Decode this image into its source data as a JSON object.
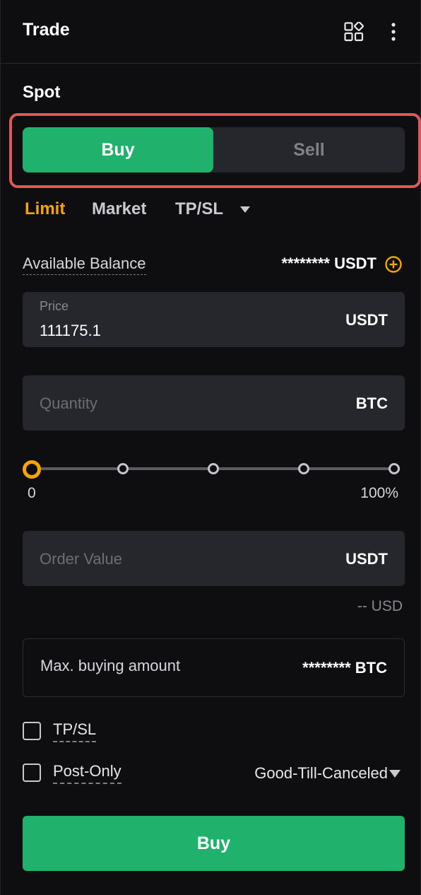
{
  "header": {
    "title": "Trade",
    "icons": [
      "grid-layout-icon",
      "more-vertical-icon"
    ]
  },
  "section_title": "Spot",
  "side_toggle": {
    "buy_label": "Buy",
    "sell_label": "Sell",
    "selected": "Buy",
    "highlighted": true
  },
  "order_types": {
    "items": [
      "Limit",
      "Market",
      "TP/SL"
    ],
    "selected": "Limit"
  },
  "balance": {
    "label": "Available Balance",
    "value": "******** USDT"
  },
  "price_field": {
    "label": "Price",
    "value": "111175.1",
    "unit": "USDT"
  },
  "quantity_field": {
    "placeholder": "Quantity",
    "unit": "BTC"
  },
  "slider": {
    "min_label": "0",
    "max_label": "100%",
    "value_percent": 0
  },
  "order_value_field": {
    "placeholder": "Order Value",
    "unit": "USDT"
  },
  "usd_estimate": "-- USD",
  "max_buy": {
    "label": "Max. buying amount",
    "value": "******** BTC"
  },
  "options": {
    "tpsl_label": "TP/SL",
    "post_only_label": "Post-Only",
    "time_in_force": "Good-Till-Canceled"
  },
  "submit": {
    "label": "Buy"
  },
  "colors": {
    "buy_green": "#20b26c",
    "accent_orange": "#f7a600",
    "highlight_red": "#e0565b",
    "background": "#0e0e10"
  }
}
